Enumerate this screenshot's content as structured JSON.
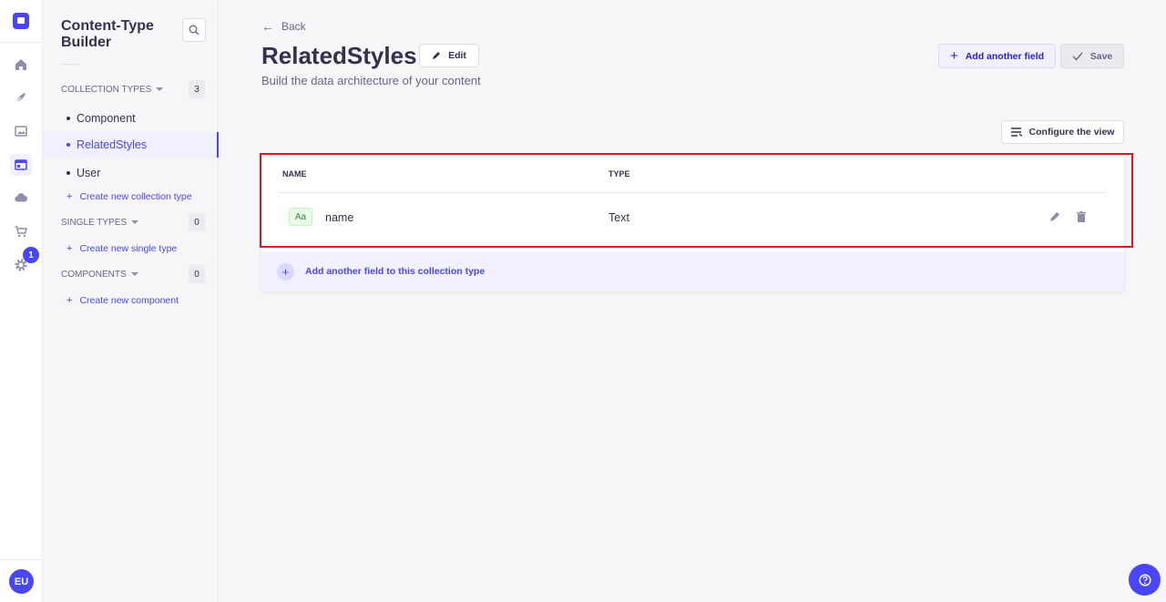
{
  "rail": {
    "logo": "strapi-logo-icon",
    "icons": [
      "home-icon",
      "content-manager-icon",
      "media-library-icon",
      "content-type-builder-icon",
      "cloud-icon",
      "marketplace-icon",
      "settings-icon"
    ],
    "settings_badge": "1",
    "avatar_initials": "EU",
    "accent": "#4945ff"
  },
  "subnav": {
    "title": "Content-Type Builder",
    "collection_types": {
      "label": "COLLECTION TYPES",
      "count": "3",
      "items": [
        {
          "label": "Component",
          "active": false
        },
        {
          "label": "RelatedStyles",
          "active": true
        },
        {
          "label": "User",
          "active": false
        }
      ],
      "create_label": "Create new collection type"
    },
    "single_types": {
      "label": "SINGLE TYPES",
      "count": "0",
      "create_label": "Create new single type"
    },
    "components": {
      "label": "COMPONENTS",
      "count": "0",
      "create_label": "Create new component"
    }
  },
  "main": {
    "back_label": "Back",
    "title": "RelatedStyles",
    "edit_label": "Edit",
    "subtitle": "Build the data architecture of your content",
    "add_field_label": "Add another field",
    "save_label": "Save",
    "configure_label": "Configure the view",
    "table": {
      "headers": {
        "name": "NAME",
        "type": "TYPE"
      },
      "rows": [
        {
          "icon": "Aa",
          "name": "name",
          "type": "Text"
        }
      ],
      "add_row_label": "Add another field to this collection type"
    },
    "highlight_color": "#e0141e"
  }
}
